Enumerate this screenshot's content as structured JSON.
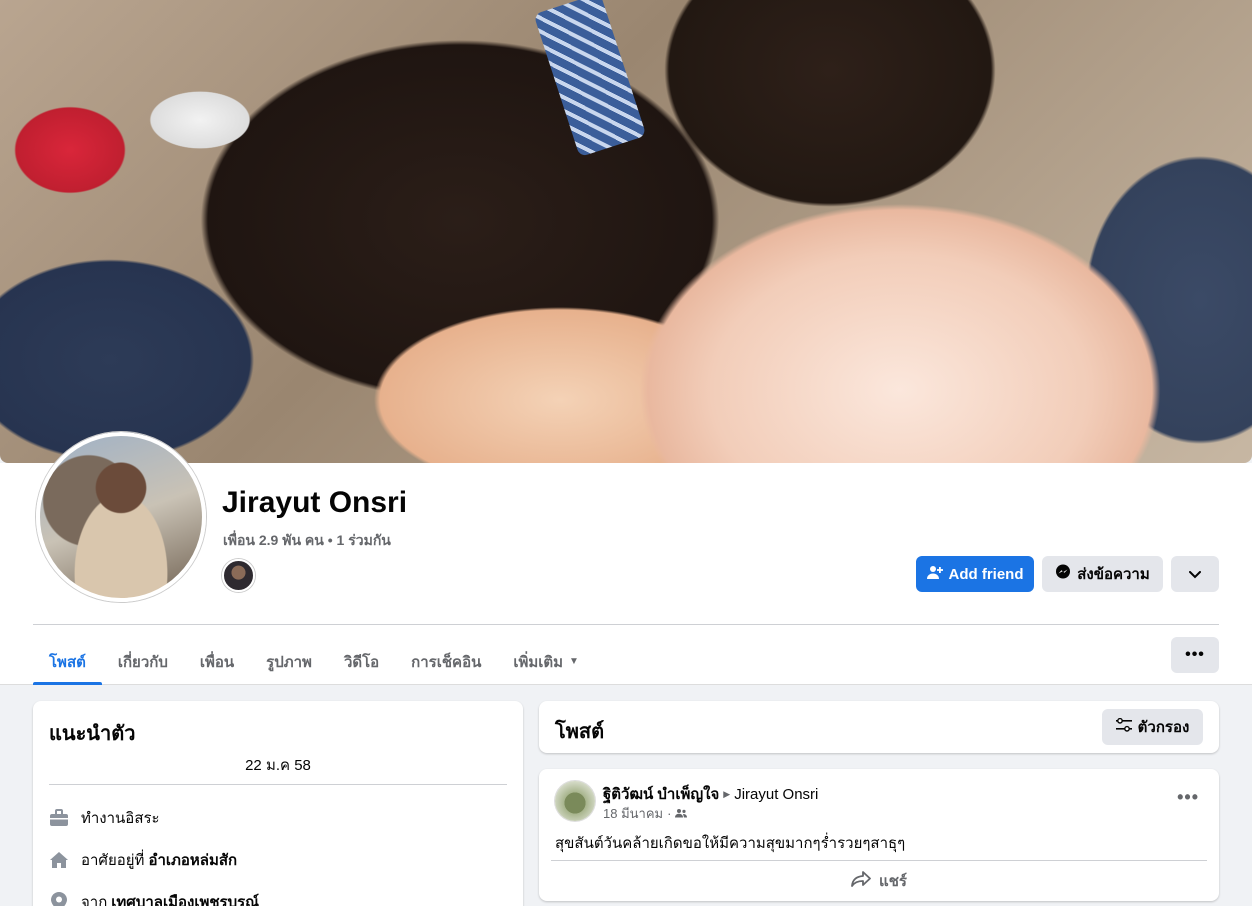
{
  "profile": {
    "name": "Jirayut Onsri",
    "friends_summary": "เพื่อน 2.9 พัน คน • 1 ร่วมกัน"
  },
  "actions": {
    "add_friend": "Add friend",
    "message": "ส่งข้อความ"
  },
  "tabs": [
    {
      "label": "โพสต์",
      "active": true
    },
    {
      "label": "เกี่ยวกับ",
      "active": false
    },
    {
      "label": "เพื่อน",
      "active": false
    },
    {
      "label": "รูปภาพ",
      "active": false
    },
    {
      "label": "วิดีโอ",
      "active": false
    },
    {
      "label": "การเช็คอิน",
      "active": false
    },
    {
      "label": "เพิ่มเติม",
      "active": false
    }
  ],
  "intro": {
    "title": "แนะนำตัว",
    "bio": "22 ม.ค 58",
    "work": "ทำงานอิสระ",
    "lives_prefix": "อาศัยอยู่ที่",
    "lives_place": "อำเภอหล่มสัก",
    "from_prefix": "จาก",
    "from_place": "เทศบาลเมืองเพชรบูรณ์"
  },
  "posts_header": {
    "title": "โพสต์",
    "filter": "ตัวกรอง"
  },
  "post": {
    "author": "ฐิติวัฒน์ บำเพ็ญใจ",
    "target": "Jirayut Onsri",
    "date": "18 มีนาคม",
    "text": "สุขสันต์วันคล้ายเกิดขอให้มีความสุขมากๆร่ำรวยๆสาธุๆ",
    "share": "แชร์"
  },
  "colors": {
    "accent": "#1b74e4",
    "secondary_button": "#e4e6eb",
    "background": "#f0f2f5"
  }
}
